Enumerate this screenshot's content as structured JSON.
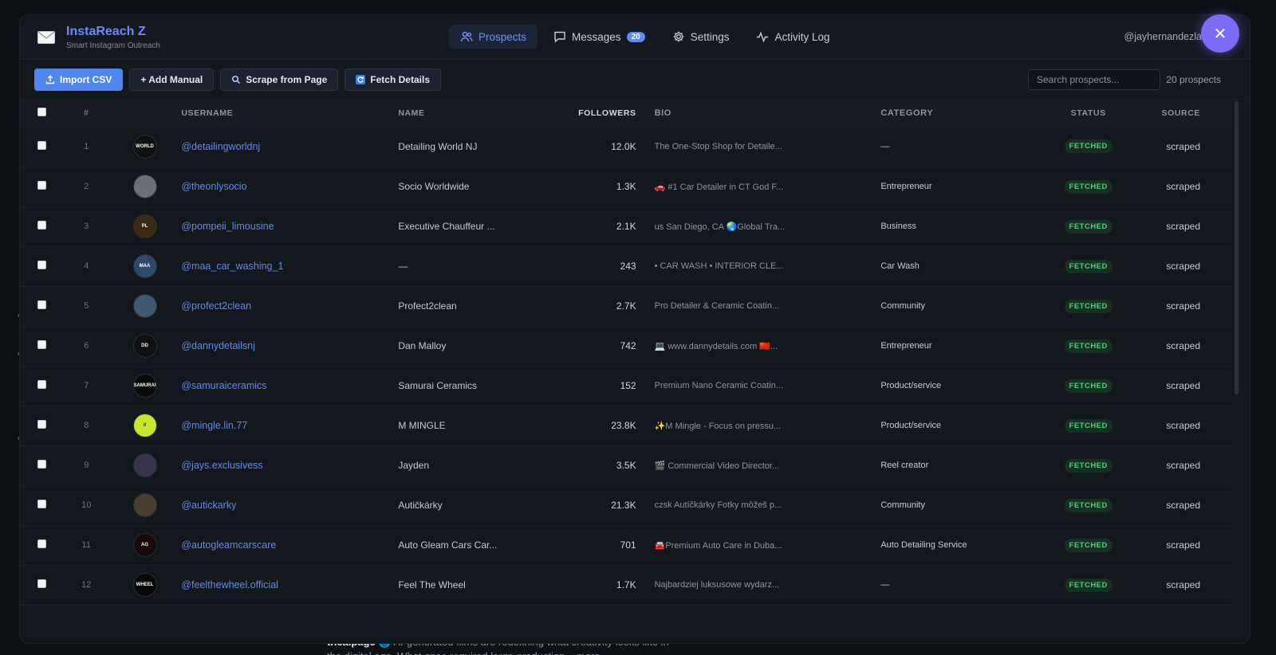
{
  "background": {
    "text_bold": "thealpage",
    "text_rest": " 🌐 AI-generated films are redefining what creativity looks like in the digital age. What once required large production... more"
  },
  "header": {
    "app_title": "InstaReach Z",
    "app_subtitle": "Smart Instagram Outreach",
    "username": "@jayhernandezla",
    "nav": [
      {
        "label": "Prospects",
        "icon": "users-icon",
        "active": true
      },
      {
        "label": "Messages",
        "icon": "message-icon",
        "badge": "20"
      },
      {
        "label": "Settings",
        "icon": "gear-icon"
      },
      {
        "label": "Activity Log",
        "icon": "activity-icon"
      }
    ],
    "close_label": "✕"
  },
  "toolbar": {
    "import_csv": "Import CSV",
    "add_manual": "+ Add Manual",
    "scrape": "Scrape from Page",
    "fetch": "Fetch Details",
    "search_placeholder": "Search prospects...",
    "count": "20 prospects"
  },
  "table": {
    "headers": {
      "num": "#",
      "username": "USERNAME",
      "name": "NAME",
      "followers": "FOLLOWERS",
      "bio": "BIO",
      "category": "CATEGORY",
      "status": "STATUS",
      "source": "SOURCE"
    },
    "rows": [
      {
        "num": "1",
        "username": "@detailingworldnj",
        "name": "Detailing World NJ",
        "followers": "12.0K",
        "bio": "The One-Stop Shop for Detaile...",
        "category": "—",
        "status": "FETCHED",
        "source": "scraped",
        "avatar_color": "#111111",
        "avatar_text": "WORLD"
      },
      {
        "num": "2",
        "username": "@theonlysocio",
        "name": "Socio Worldwide",
        "followers": "1.3K",
        "bio": "🚗 #1 Car Detailer in CT God F...",
        "category": "Entrepreneur",
        "status": "FETCHED",
        "source": "scraped",
        "avatar_color": "#6b6f7a",
        "avatar_text": ""
      },
      {
        "num": "3",
        "username": "@pompeii_limousine",
        "name": "Executive Chauffeur ...",
        "followers": "2.1K",
        "bio": "us San Diego, CA 🌏Global Tra...",
        "category": "Business",
        "status": "FETCHED",
        "source": "scraped",
        "avatar_color": "#3a2a12",
        "avatar_text": "PL"
      },
      {
        "num": "4",
        "username": "@maa_car_washing_1",
        "name": "—",
        "followers": "243",
        "bio": "• CAR WASH • INTERIOR CLE...",
        "category": "Car Wash",
        "status": "FETCHED",
        "source": "scraped",
        "avatar_color": "#2e4a6a",
        "avatar_text": "MAA"
      },
      {
        "num": "5",
        "username": "@profect2clean",
        "name": "Profect2clean",
        "followers": "2.7K",
        "bio": "Pro Detailer & Ceramic Coatin...",
        "category": "Community",
        "status": "FETCHED",
        "source": "scraped",
        "avatar_color": "#3f5a70",
        "avatar_text": ""
      },
      {
        "num": "6",
        "username": "@dannydetailsnj",
        "name": "Dan Malloy",
        "followers": "742",
        "bio": "💻 www.dannydetails.com 🇨🇳...",
        "category": "Entrepreneur",
        "status": "FETCHED",
        "source": "scraped",
        "avatar_color": "#111111",
        "avatar_text": "DD"
      },
      {
        "num": "7",
        "username": "@samuraiceramics",
        "name": "Samurai Ceramics",
        "followers": "152",
        "bio": "Premium Nano Ceramic Coatin...",
        "category": "Product/service",
        "status": "FETCHED",
        "source": "scraped",
        "avatar_color": "#0a0a0a",
        "avatar_text": "SAMURAI"
      },
      {
        "num": "8",
        "username": "@mingle.lin.77",
        "name": "M MINGLE",
        "followers": "23.8K",
        "bio": "✨M Mingle - Focus on pressu...",
        "category": "Product/service",
        "status": "FETCHED",
        "source": "scraped",
        "avatar_color": "#c9e62a",
        "avatar_text": "//"
      },
      {
        "num": "9",
        "username": "@jays.exclusivess",
        "name": "Jayden",
        "followers": "3.5K",
        "bio": "🎬 Commercial Video Director...",
        "category": "Reel creator",
        "status": "FETCHED",
        "source": "scraped",
        "avatar_color": "#3a3350",
        "avatar_text": ""
      },
      {
        "num": "10",
        "username": "@autickarky",
        "name": "Autičkárky",
        "followers": "21.3K",
        "bio": "czsk Autíčkárky Fotky môžeš p...",
        "category": "Community",
        "status": "FETCHED",
        "source": "scraped",
        "avatar_color": "#4a3e2c",
        "avatar_text": ""
      },
      {
        "num": "11",
        "username": "@autogleamcarscare",
        "name": "Auto Gleam Cars Car...",
        "followers": "701",
        "bio": "🚘Premium Auto Care in Duba...",
        "category": "Auto Detailing Service",
        "status": "FETCHED",
        "source": "scraped",
        "avatar_color": "#1a0a0a",
        "avatar_text": "AG"
      },
      {
        "num": "12",
        "username": "@feelthewheel.official",
        "name": "Feel The Wheel",
        "followers": "1.7K",
        "bio": "Najbardziej luksusowe wydarz...",
        "category": "—",
        "status": "FETCHED",
        "source": "scraped",
        "avatar_color": "#0a0a0a",
        "avatar_text": "WHEEL"
      }
    ]
  }
}
